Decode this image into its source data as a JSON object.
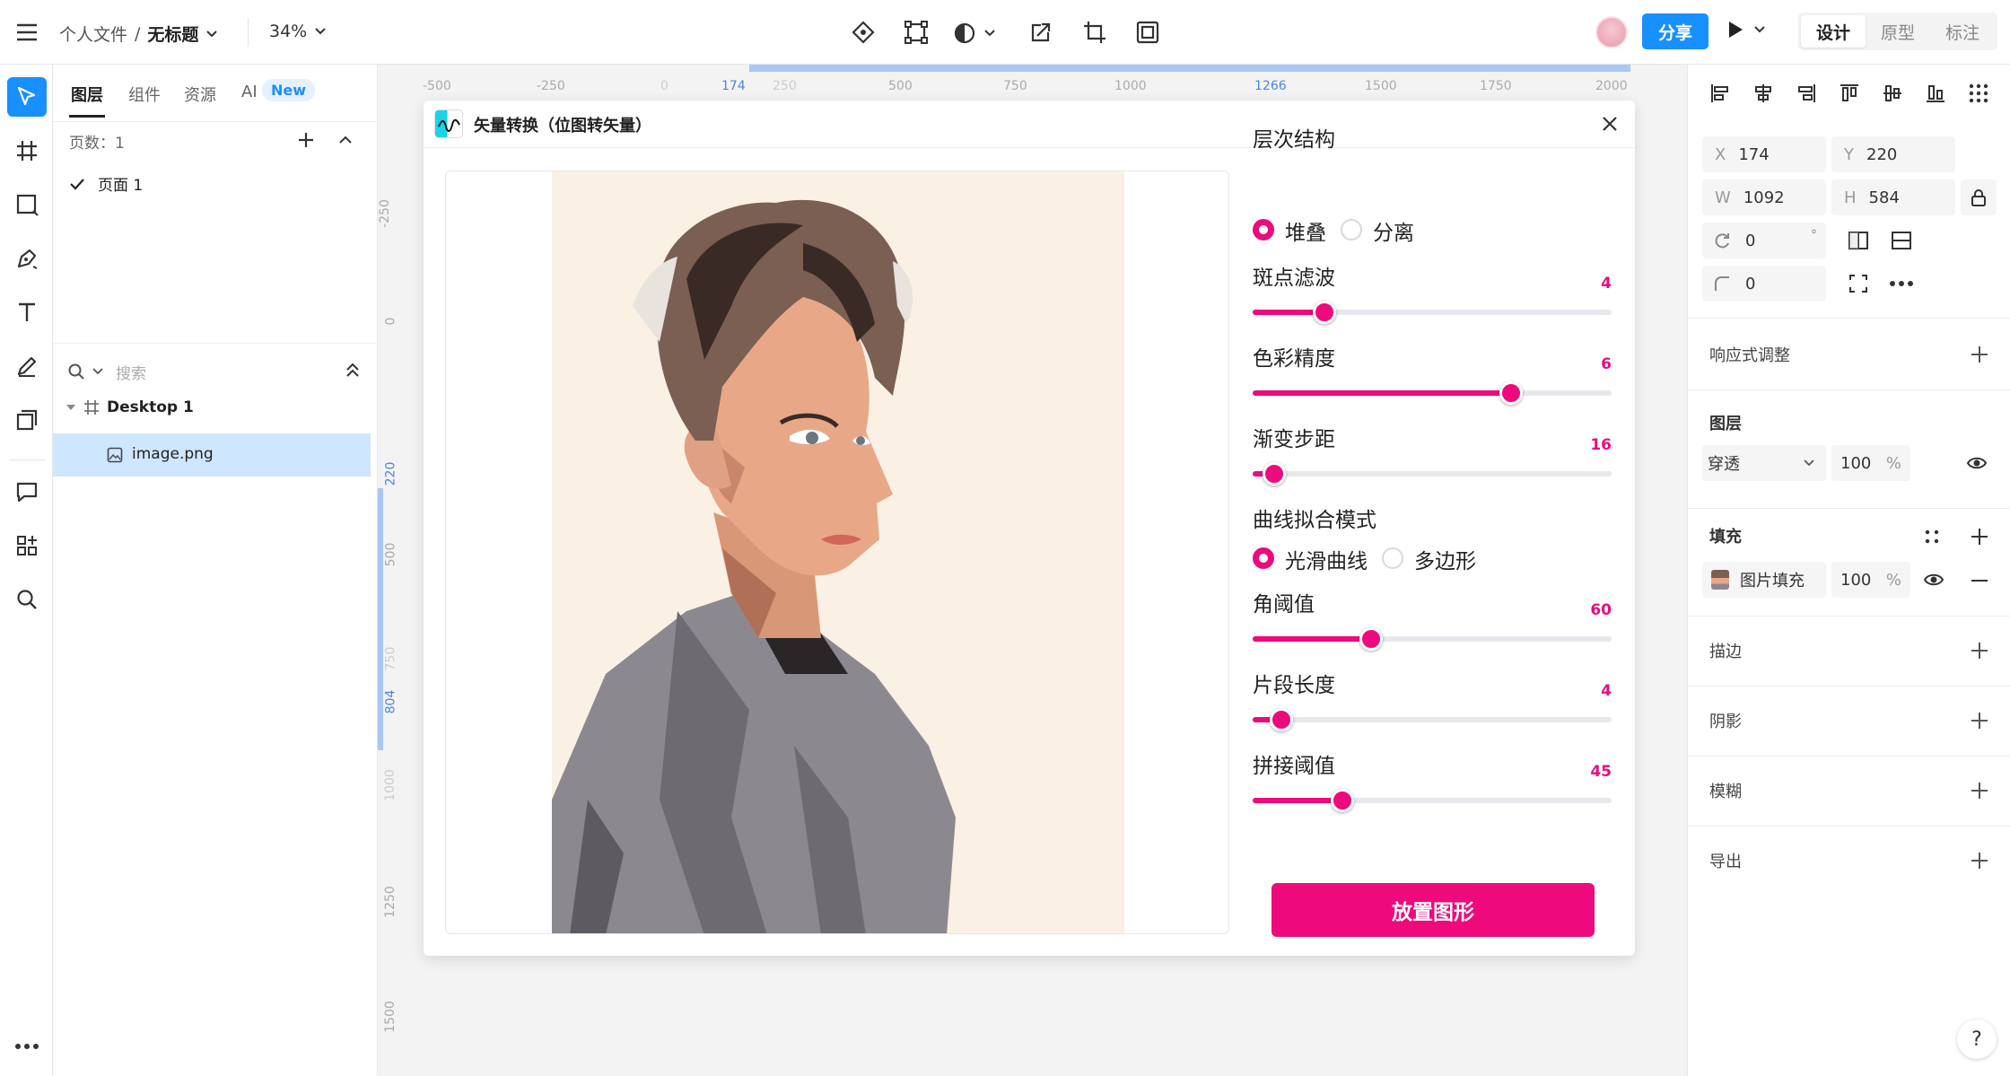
{
  "topbar": {
    "breadcrumb_parent": "个人文件",
    "breadcrumb_sep": "/",
    "file_name": "无标题",
    "zoom": "34%",
    "share_label": "分享",
    "mode_tabs": [
      "设计",
      "原型",
      "标注"
    ]
  },
  "left_panel": {
    "tabs": [
      "图层",
      "组件",
      "资源",
      "AI"
    ],
    "ai_badge": "New",
    "page_count_label": "页数：1",
    "pages": [
      "页面 1"
    ],
    "search_placeholder": "搜索",
    "layers": {
      "frame": "Desktop 1",
      "child": "image.png"
    }
  },
  "rulers": {
    "top": [
      "-500",
      "-250",
      "0",
      "174",
      "250",
      "500",
      "750",
      "1000",
      "1266",
      "1500",
      "1750",
      "2000"
    ],
    "left": [
      "-250",
      "0",
      "220",
      "500",
      "750",
      "804",
      "1000",
      "1250",
      "1500"
    ]
  },
  "dialog": {
    "title": "矢量转换（位图转矢量）",
    "hierarchy_label": "层次结构",
    "hierarchy_options": [
      "堆叠",
      "分离"
    ],
    "hierarchy_selected": 0,
    "curve_label": "曲线拟合模式",
    "curve_options": [
      "光滑曲线",
      "多边形"
    ],
    "curve_selected": 0,
    "sliders": [
      {
        "label": "斑点滤波",
        "value": "4",
        "fraction": 0.2
      },
      {
        "label": "色彩精度",
        "value": "6",
        "fraction": 0.72
      },
      {
        "label": "渐变步距",
        "value": "16",
        "fraction": 0.06
      },
      {
        "label": "角阈值",
        "value": "60",
        "fraction": 0.33
      },
      {
        "label": "片段长度",
        "value": "4",
        "fraction": 0.08
      },
      {
        "label": "拼接阈值",
        "value": "45",
        "fraction": 0.25
      }
    ],
    "place_button": "放置图形"
  },
  "right_panel": {
    "x_label": "X",
    "x": "174",
    "y_label": "Y",
    "y": "220",
    "w_label": "W",
    "w": "1092",
    "h_label": "H",
    "h": "584",
    "rotation": "0",
    "degree": "°",
    "radius": "0",
    "responsive": "响应式调整",
    "layer_section": "图层",
    "blend_mode": "穿透",
    "layer_opacity": "100",
    "percent": "%",
    "fill_section": "填充",
    "fill_type": "图片填充",
    "fill_opacity": "100",
    "stroke": "描边",
    "shadow": "阴影",
    "blur": "模糊",
    "export": "导出"
  },
  "colors": {
    "accent": "#1890ff",
    "brand_pink": "#ee0a7c",
    "selection": "#cfe6ff"
  },
  "help": "?"
}
